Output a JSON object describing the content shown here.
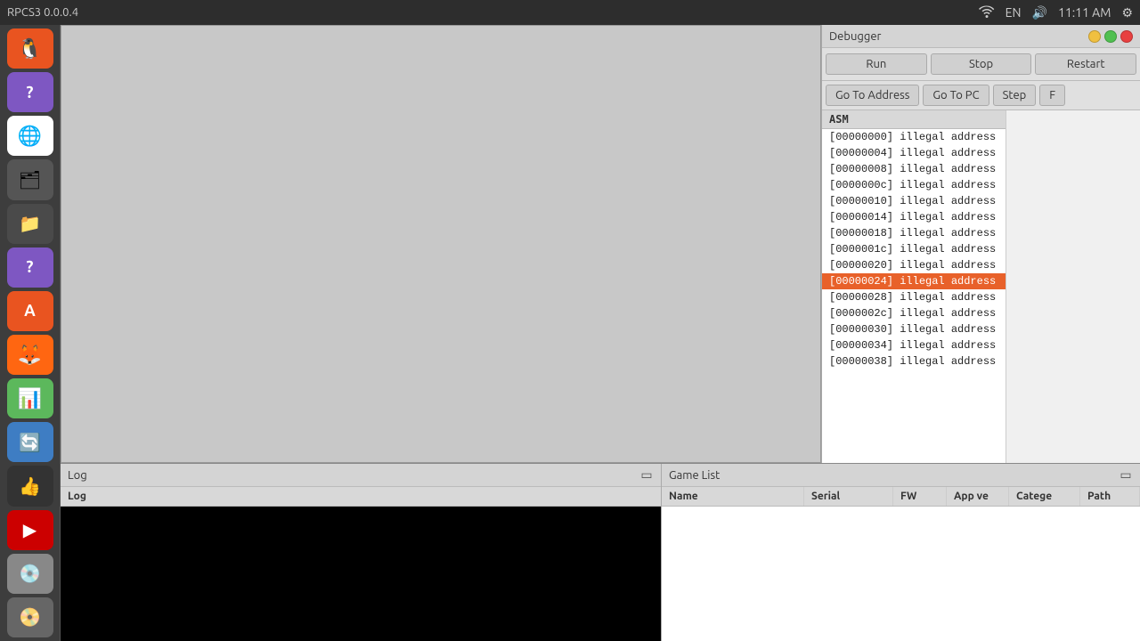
{
  "titlebar": {
    "title": "RPCS3 0.0.0.4",
    "time": "11:11 AM",
    "lang": "EN"
  },
  "debugger": {
    "title": "Debugger",
    "buttons": {
      "run": "Run",
      "stop": "Stop",
      "restart": "Restart",
      "go_to_address": "Go To Address",
      "go_to_pc": "Go To PC",
      "step": "Step",
      "extra": "F"
    },
    "asm_header": "ASM",
    "asm_rows": [
      {
        "address": "[00000000]",
        "text": " illegal address",
        "selected": false
      },
      {
        "address": "[00000004]",
        "text": " illegal address",
        "selected": false
      },
      {
        "address": "[00000008]",
        "text": " illegal address",
        "selected": false
      },
      {
        "address": "[0000000c]",
        "text": " illegal address",
        "selected": false
      },
      {
        "address": "[00000010]",
        "text": " illegal address",
        "selected": false
      },
      {
        "address": "[00000014]",
        "text": " illegal address",
        "selected": false
      },
      {
        "address": "[00000018]",
        "text": " illegal address",
        "selected": false
      },
      {
        "address": "[0000001c]",
        "text": " illegal address",
        "selected": false
      },
      {
        "address": "[00000020]",
        "text": " illegal address",
        "selected": false
      },
      {
        "address": "[00000024]",
        "text": " illegal address",
        "selected": true
      },
      {
        "address": "[00000028]",
        "text": " illegal address",
        "selected": false
      },
      {
        "address": "[0000002c]",
        "text": " illegal address",
        "selected": false
      },
      {
        "address": "[00000030]",
        "text": " illegal address",
        "selected": false
      },
      {
        "address": "[00000034]",
        "text": " illegal address",
        "selected": false
      },
      {
        "address": "[00000038]",
        "text": " illegal address",
        "selected": false
      }
    ]
  },
  "log": {
    "title": "Log",
    "header": "Log"
  },
  "gamelist": {
    "title": "Game List",
    "columns": {
      "name": "Name",
      "serial": "Serial",
      "fw": "FW",
      "app_ver": "App ve",
      "category": "Categе",
      "path": "Path"
    }
  },
  "sidebar": {
    "apps": [
      {
        "name": "ubuntu-icon",
        "label": "Ubuntu",
        "emoji": "🐧"
      },
      {
        "name": "help-icon",
        "label": "Help",
        "emoji": "?"
      },
      {
        "name": "chrome-icon",
        "label": "Chrome",
        "emoji": "🌐"
      },
      {
        "name": "files-icon",
        "label": "Files",
        "emoji": "🗂"
      },
      {
        "name": "folder-icon",
        "label": "Folder",
        "emoji": "📁"
      },
      {
        "name": "help2-icon",
        "label": "Help2",
        "emoji": "?"
      },
      {
        "name": "appstore-icon",
        "label": "App Store",
        "emoji": "A"
      },
      {
        "name": "firefox-icon",
        "label": "Firefox",
        "emoji": "🦊"
      },
      {
        "name": "calc-icon",
        "label": "Calc",
        "emoji": "📊"
      },
      {
        "name": "update-icon",
        "label": "Update",
        "emoji": "🔄"
      },
      {
        "name": "thumb-icon",
        "label": "Thumb",
        "emoji": "👍"
      },
      {
        "name": "tube-icon",
        "label": "Tube",
        "emoji": "▶"
      },
      {
        "name": "disk1-icon",
        "label": "Disk1",
        "emoji": "💿"
      },
      {
        "name": "dvd-icon",
        "label": "DVD",
        "emoji": "📀"
      }
    ]
  },
  "colors": {
    "selected_row_bg": "#e8612a",
    "selected_row_text": "#ffffff",
    "asm_bg": "#ffffff",
    "debugger_bg": "#e8e8e8"
  }
}
